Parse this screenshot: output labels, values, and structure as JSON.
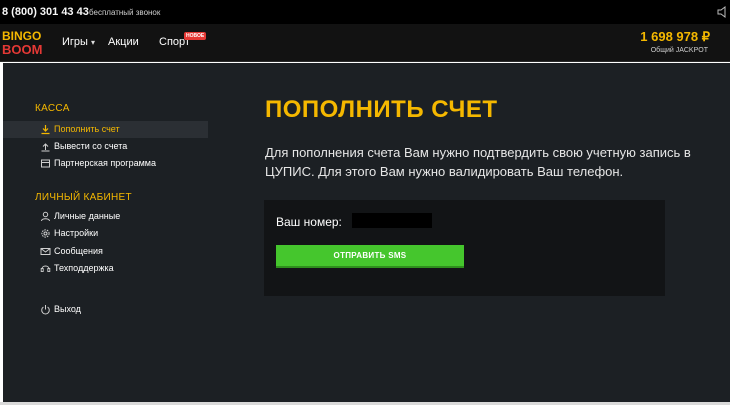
{
  "top_bar": {
    "phone": "8 (800) 301 43 43",
    "free_call": "бесплатный звонок",
    "speaker_icon": "speaker-icon"
  },
  "header": {
    "logo_text": [
      "BINGO",
      "BOOM"
    ],
    "nav": {
      "games": "Игры",
      "actions": "Акции",
      "sport": "Спорт",
      "new_badge": "НОВОЕ"
    },
    "jackpot": {
      "amount": "1 698 978 ₽",
      "label": "Общий JACKPOT"
    }
  },
  "sidebar": {
    "kassa_title": "КАССА",
    "kassa_items": [
      {
        "label": "Пополнить счет",
        "icon": "deposit-icon",
        "active": true
      },
      {
        "label": "Вывести со счета",
        "icon": "withdraw-icon",
        "active": false
      },
      {
        "label": "Партнерская программа",
        "icon": "partner-icon",
        "active": false
      }
    ],
    "cabinet_title": "ЛИЧНЫЙ КАБИНЕТ",
    "cabinet_items": [
      {
        "label": "Личные данные",
        "icon": "user-icon"
      },
      {
        "label": "Настройки",
        "icon": "gear-icon"
      },
      {
        "label": "Сообщения",
        "icon": "mail-icon"
      },
      {
        "label": "Техподдержка",
        "icon": "support-icon"
      }
    ],
    "logout": {
      "label": "Выход",
      "icon": "power-icon"
    }
  },
  "content": {
    "title": "ПОПОЛНИТЬ СЧЕТ",
    "description": "Для пополнения счета Вам нужно подтвердить свою учетную запись в ЦУПИС. Для этого Вам нужно валидировать Ваш телефон.",
    "number_label": "Ваш номер:",
    "send_sms": "ОТПРАВИТЬ SMS"
  },
  "colors": {
    "accent": "#f5b800",
    "button_green": "#45c62d",
    "background": "#1c2024"
  }
}
